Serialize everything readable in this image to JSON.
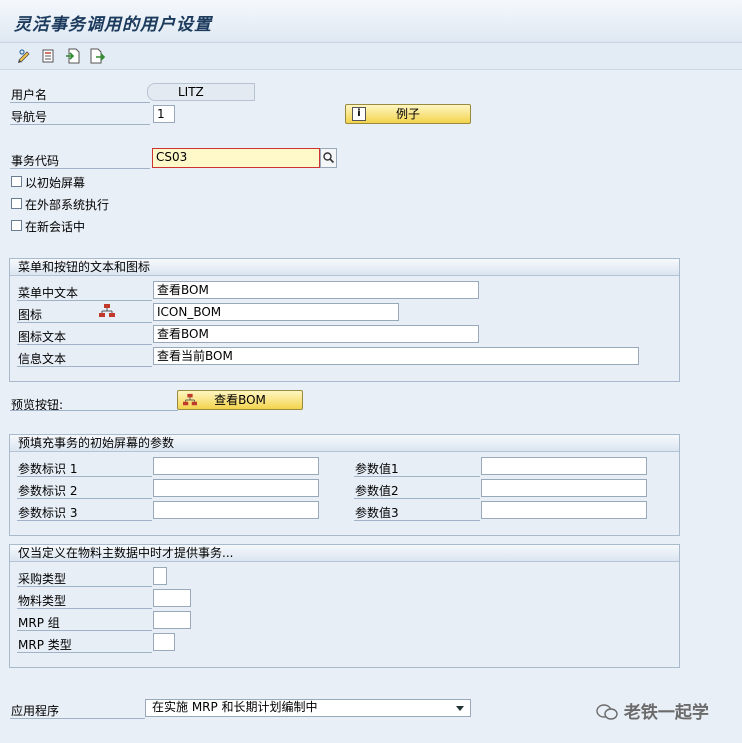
{
  "window": {
    "title": "灵活事务调用的用户设置"
  },
  "toolbar": {
    "icons": [
      "edit-icon",
      "settings-list-icon",
      "import-icon",
      "export-icon"
    ]
  },
  "form": {
    "username_label": "用户名",
    "username_value": "LITZ",
    "nav_label": "导航号",
    "nav_value": "1",
    "example_button": "例子",
    "tcode_label": "事务代码",
    "tcode_value": "CS03",
    "checkboxes": [
      {
        "label": "以初始屏幕",
        "checked": false
      },
      {
        "label": "在外部系统执行",
        "checked": false
      },
      {
        "label": "在新会话中",
        "checked": false
      }
    ]
  },
  "menu_group": {
    "title": "菜单和按钮的文本和图标",
    "menu_text_label": "菜单中文本",
    "menu_text_value": "查看BOM",
    "icon_label": "图标",
    "icon_value": "ICON_BOM",
    "icon_text_label": "图标文本",
    "icon_text_value": "查看BOM",
    "info_text_label": "信息文本",
    "info_text_value": "查看当前BOM"
  },
  "preview": {
    "label": "预览按钮:",
    "button": "查看BOM"
  },
  "params_group": {
    "title": "预填充事务的初始屏幕的参数",
    "rows": [
      {
        "id_label": "参数标识 1",
        "id_value": "",
        "val_label": "参数值1",
        "val_value": ""
      },
      {
        "id_label": "参数标识 2",
        "id_value": "",
        "val_label": "参数值2",
        "val_value": ""
      },
      {
        "id_label": "参数标识 3",
        "id_value": "",
        "val_label": "参数值3",
        "val_value": ""
      }
    ]
  },
  "material_group": {
    "title": "仅当定义在物料主数据中时才提供事务...",
    "purchase_type_label": "采购类型",
    "material_type_label": "物料类型",
    "mrp_group_label": "MRP 组",
    "mrp_type_label": "MRP 类型"
  },
  "application": {
    "label": "应用程序",
    "selected": "在实施 MRP 和长期计划编制中"
  },
  "watermark": {
    "text": "老铁一起学"
  }
}
